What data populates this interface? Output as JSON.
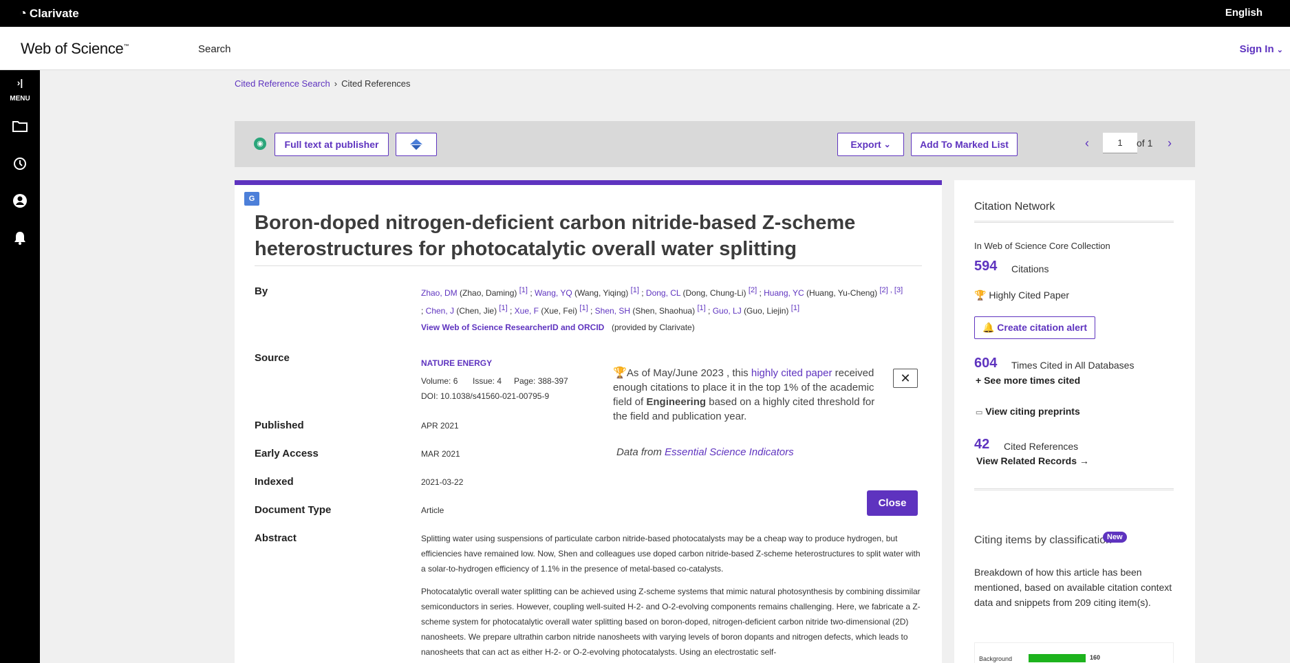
{
  "topbar": {
    "brand": "Clarivate",
    "language": "English"
  },
  "header": {
    "logo": "Web of Science",
    "logo_tm": "™",
    "search": "Search",
    "signin": "Sign In"
  },
  "sidebar": {
    "menu_label": "MENU"
  },
  "breadcrumb": {
    "parent": "Cited Reference Search",
    "current": "Cited References"
  },
  "toolbar": {
    "fulltext": "Full text at publisher",
    "export": "Export",
    "add_marked": "Add To Marked List",
    "page": "1",
    "of": "of 1"
  },
  "record": {
    "title": "Boron-doped nitrogen-deficient carbon nitride-based Z-scheme heterostructures for photocatalytic overall water splitting",
    "labels": {
      "by": "By",
      "source": "Source",
      "published": "Published",
      "early_access": "Early Access",
      "indexed": "Indexed",
      "doc_type": "Document Type",
      "abstract": "Abstract"
    },
    "authors": [
      {
        "short": "Zhao, DM",
        "full": "(Zhao, Daming)",
        "refs": "[1]"
      },
      {
        "short": "Wang, YQ",
        "full": "(Wang, Yiqing)",
        "refs": "[1]"
      },
      {
        "short": "Dong, CL",
        "full": "(Dong, Chung-Li)",
        "refs": "[2]"
      },
      {
        "short": "Huang, YC",
        "full": "(Huang, Yu-Cheng)",
        "refs": "[2] , [3]"
      },
      {
        "short": "Chen, J",
        "full": "(Chen, Jie)",
        "refs": "[1]"
      },
      {
        "short": "Xue, F",
        "full": "(Xue, Fei)",
        "refs": "[1]"
      },
      {
        "short": "Shen, SH",
        "full": "(Shen, Shaohua)",
        "refs": "[1]"
      },
      {
        "short": "Guo, LJ",
        "full": "(Guo, Liejin)",
        "refs": "[1]"
      }
    ],
    "researcher_link": "View Web of Science ResearcherID and ORCID",
    "provided_by": "(provided by Clarivate)",
    "journal": "NATURE ENERGY",
    "volume": "Volume: 6",
    "issue": "Issue: 4",
    "pages": "Page: 388-397",
    "doi": "DOI: 10.1038/s41560-021-00795-9",
    "published": "APR 2021",
    "early_access": "MAR 2021",
    "indexed": "2021-03-22",
    "doc_type": "Article",
    "abstract_p1": "Splitting water using suspensions of particulate carbon nitride-based photocatalysts may be a cheap way to produce hydrogen, but efficiencies have remained low. Now, Shen and colleagues use doped carbon nitride-based Z-scheme heterostructures to split water with a solar-to-hydrogen efficiency of 1.1% in the presence of metal-based co-catalysts.",
    "abstract_p2": "Photocatalytic overall water splitting can be achieved using Z-scheme systems that mimic natural photosynthesis by combining dissimilar semiconductors in series. However, coupling well-suited H-2- and O-2-evolving components remains challenging. Here, we fabricate a Z-scheme system for photocatalytic overall water splitting based on boron-doped, nitrogen-deficient carbon nitride two-dimensional (2D) nanosheets. We prepare ultrathin carbon nitride nanosheets with varying levels of boron dopants and nitrogen defects, which leads to nanosheets that can act as either H-2- or O-2-evolving photocatalysts. Using an electrostatic self-"
  },
  "popup": {
    "text_pre": "As of May/June 2023 , this",
    "link": "highly cited paper",
    "text_mid": "received enough citations to place it in the top 1% of the academic field of",
    "field": "Engineering",
    "text_post": "based on a highly cited threshold for the field and publication year.",
    "data_from": "Data from",
    "data_link": "Essential Science Indicators",
    "close_x": "✕",
    "close": "Close"
  },
  "citation_network": {
    "title": "Citation Network",
    "collection": "In Web of Science Core Collection",
    "citations_count": "594",
    "citations_label": "Citations",
    "hcp_label": "Highly Cited Paper",
    "alert_btn": "Create citation alert",
    "all_db_count": "604",
    "all_db_label": "Times Cited in All Databases",
    "see_more": "See more times cited",
    "preprints": "View citing preprints",
    "refs_count": "42",
    "refs_label": "Cited References",
    "related": "View Related Records",
    "classification_title": "Citing items by classification",
    "new_badge": "New",
    "breakdown": "Breakdown of how this article has been mentioned, based on available citation context data and snippets from 209 citing item(s).",
    "chart_label": "Background",
    "chart_value": "160",
    "chart_fraction": 0.766
  },
  "colors": {
    "accent": "#5e33bf",
    "bar": "#1db31d"
  }
}
